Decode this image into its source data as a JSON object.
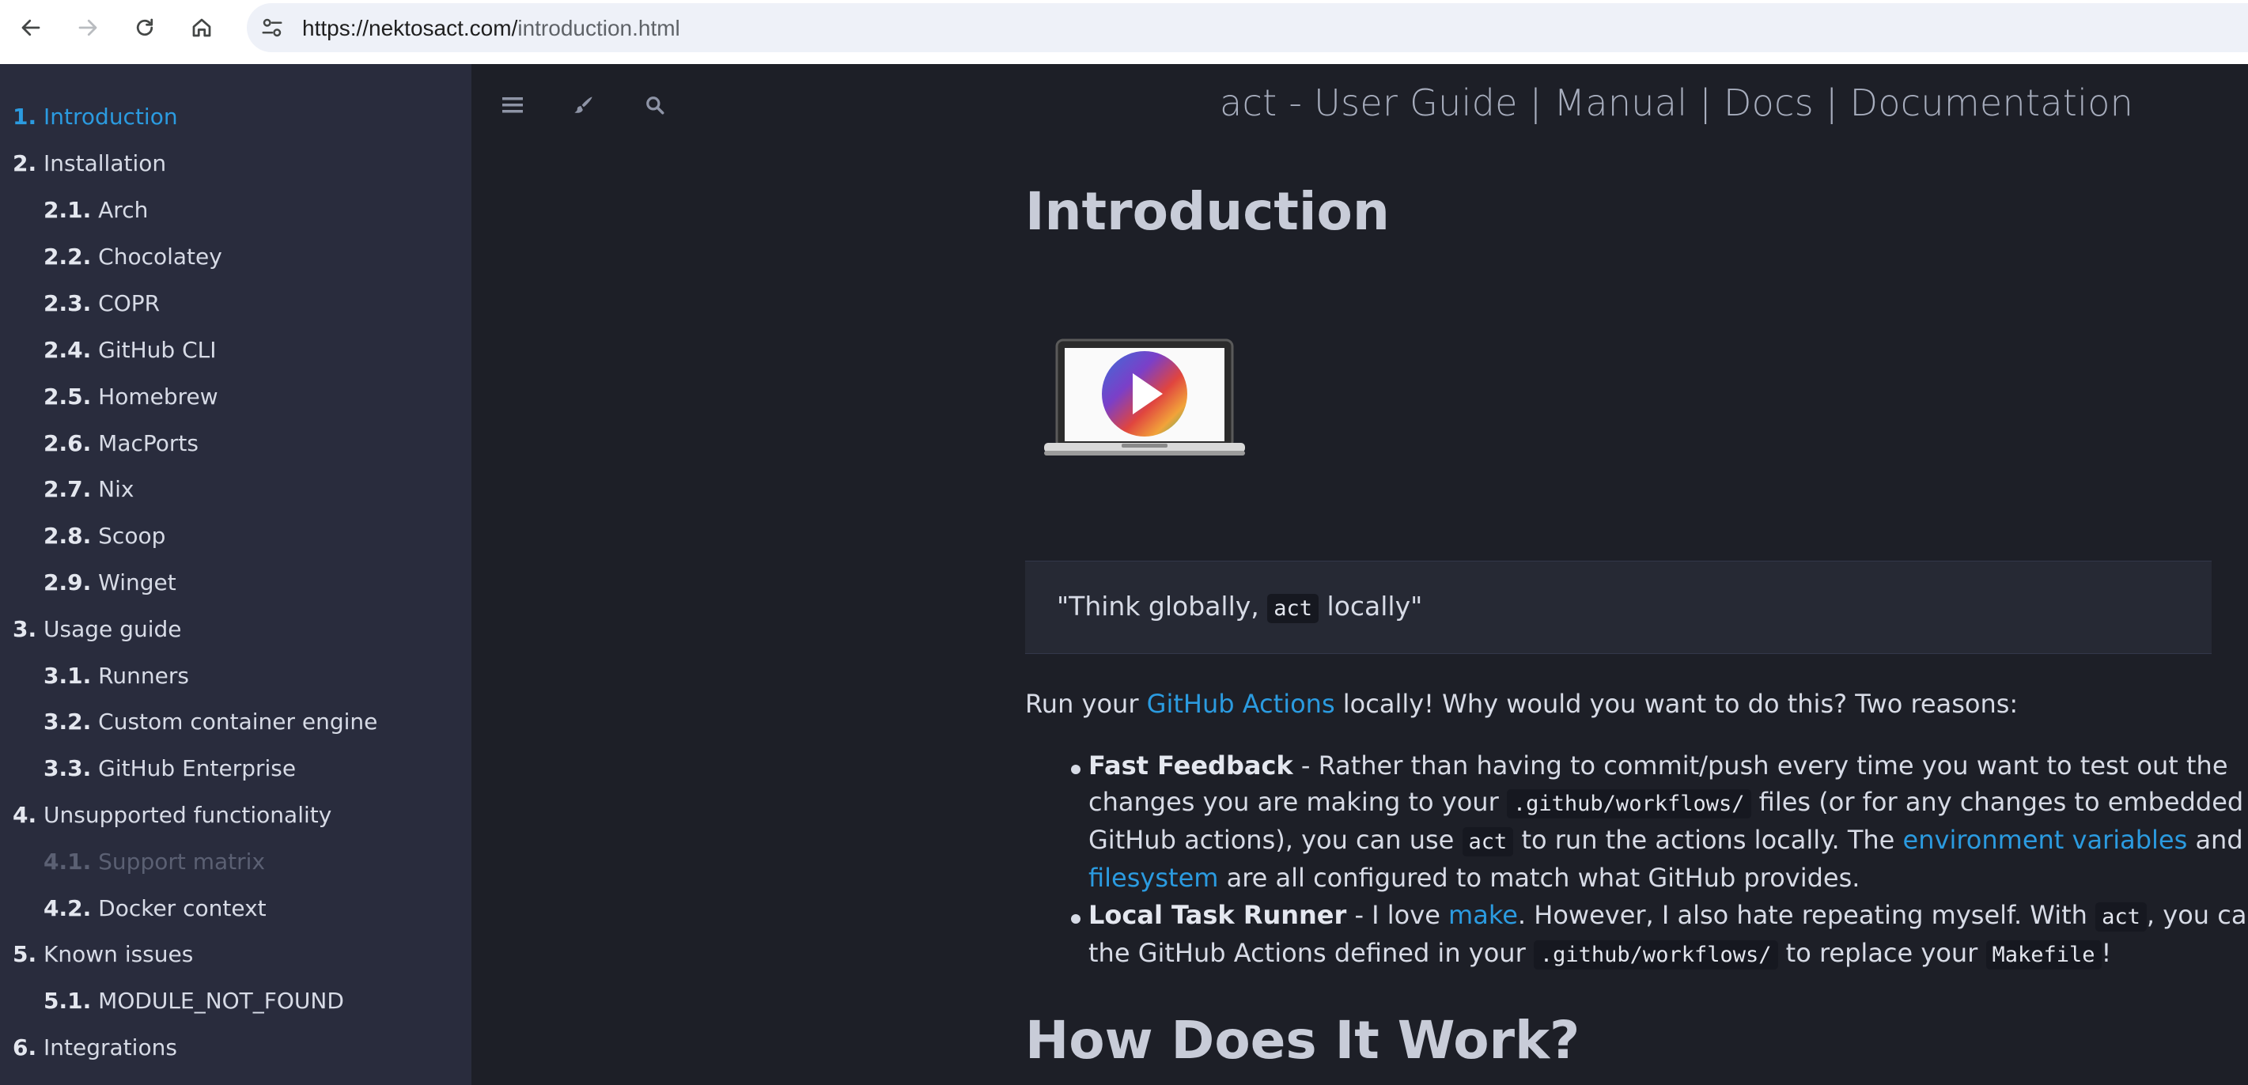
{
  "browser": {
    "url_host": "https://nektosact.com/",
    "url_path": "introduction.html"
  },
  "sidebar": {
    "items": [
      {
        "num": "1.",
        "label": "Introduction"
      },
      {
        "num": "2.",
        "label": "Installation"
      },
      {
        "num": "2.1.",
        "label": "Arch"
      },
      {
        "num": "2.2.",
        "label": "Chocolatey"
      },
      {
        "num": "2.3.",
        "label": "COPR"
      },
      {
        "num": "2.4.",
        "label": "GitHub CLI"
      },
      {
        "num": "2.5.",
        "label": "Homebrew"
      },
      {
        "num": "2.6.",
        "label": "MacPorts"
      },
      {
        "num": "2.7.",
        "label": "Nix"
      },
      {
        "num": "2.8.",
        "label": "Scoop"
      },
      {
        "num": "2.9.",
        "label": "Winget"
      },
      {
        "num": "3.",
        "label": "Usage guide"
      },
      {
        "num": "3.1.",
        "label": "Runners"
      },
      {
        "num": "3.2.",
        "label": "Custom container engine"
      },
      {
        "num": "3.3.",
        "label": "GitHub Enterprise"
      },
      {
        "num": "4.",
        "label": "Unsupported functionality"
      },
      {
        "num": "4.1.",
        "label": "Support matrix"
      },
      {
        "num": "4.2.",
        "label": "Docker context"
      },
      {
        "num": "5.",
        "label": "Known issues"
      },
      {
        "num": "5.1.",
        "label": "MODULE_NOT_FOUND"
      },
      {
        "num": "6.",
        "label": "Integrations"
      }
    ]
  },
  "menu_bar": {
    "title": "act - User Guide | Manual | Docs | Documentation"
  },
  "main": {
    "heading": "Introduction",
    "quote": {
      "before": "\"Think globally, ",
      "code": "act",
      "after": " locally\""
    },
    "intro": {
      "before": "Run your ",
      "link": "GitHub Actions",
      "after": " locally! Why would you want to do this? Two reasons:"
    },
    "bullet1": {
      "title": "Fast Feedback",
      "l1": " - Rather than having to commit/push every time you want to test out the",
      "l2_a": "changes you are making to your ",
      "l2_code": ".github/workflows/",
      "l2_b": " files (or for any changes to embedded",
      "l3_a": "GitHub actions), you can use ",
      "l3_code": "act",
      "l3_b": " to run the actions locally. The ",
      "l3_link": "environment variables",
      "l3_c": " and",
      "l4_link": "filesystem",
      "l4_b": " are all configured to match what GitHub provides."
    },
    "bullet2": {
      "title": "Local Task Runner",
      "l1_a": " - I love ",
      "l1_link": "make",
      "l1_b": ". However, I also hate repeating myself. With ",
      "l1_code": "act",
      "l1_c": ", you can use",
      "l2_a": "the GitHub Actions defined in your ",
      "l2_code": ".github/workflows/",
      "l2_b": " to replace your ",
      "l2_code2": "Makefile",
      "l2_c": "!"
    },
    "heading2": "How Does It Work?"
  }
}
